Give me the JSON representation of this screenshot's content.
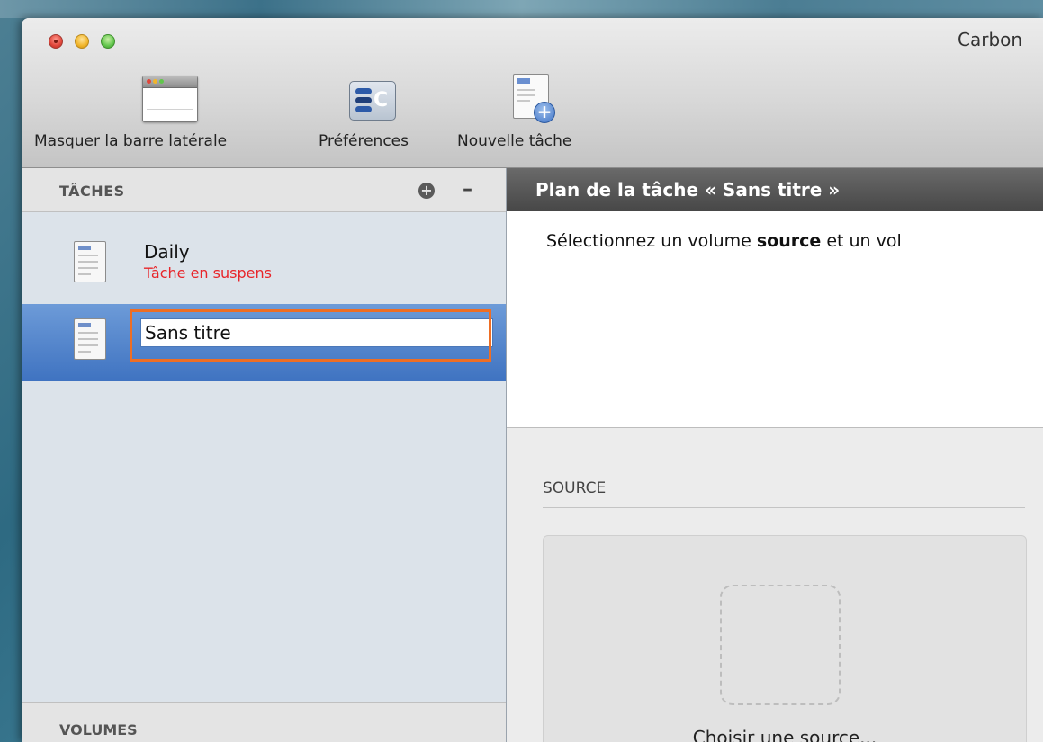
{
  "window": {
    "title": "Carbon"
  },
  "toolbar": {
    "hide_sidebar_label": "Masquer la barre latérale",
    "preferences_label": "Préférences",
    "new_task_label": "Nouvelle tâche"
  },
  "sidebar": {
    "tasks_title": "TÂCHES",
    "add_icon": "plus-circle-icon",
    "remove_icon": "minus-icon",
    "tasks": [
      {
        "name": "Daily",
        "status": "Tâche en suspens"
      },
      {
        "name": "Sans titre",
        "status": "",
        "editing": true
      }
    ],
    "volumes_title": "VOLUMES"
  },
  "main": {
    "header_title": "Plan de la tâche « Sans titre »",
    "instruction_prefix": "Sélectionnez un volume ",
    "instruction_bold": "source",
    "instruction_suffix": " et un vol",
    "source_label": "SOURCE",
    "choose_source": "Choisir une source..."
  },
  "colors": {
    "status_red": "#e8252a",
    "selection_blue": "#3f73c1",
    "highlight_orange": "#ee6e24",
    "header_dark": "#474747"
  }
}
